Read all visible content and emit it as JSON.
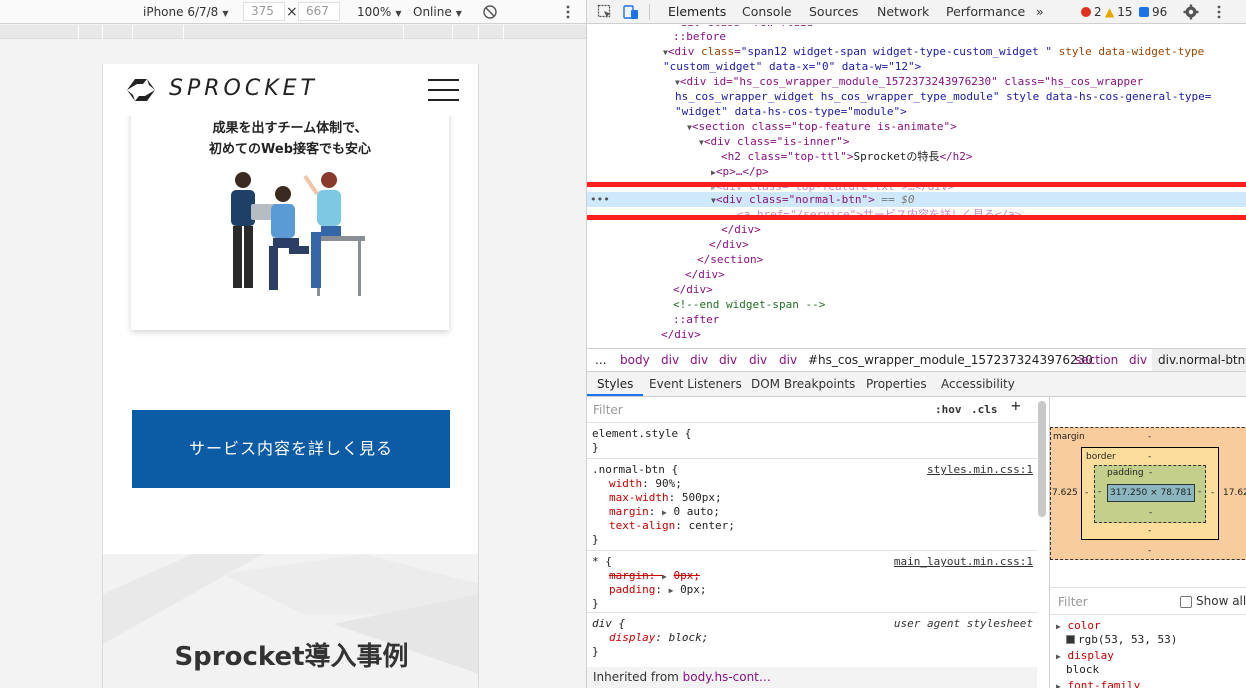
{
  "device_toolbar": {
    "device": "iPhone 6/7/8",
    "width": "375",
    "times": "×",
    "height": "667",
    "zoom": "100%",
    "network": "Online"
  },
  "site": {
    "logo_text": "SPROCKET",
    "feature_line1": "成果を出すチーム体制で、",
    "feature_line2": "初めてのWeb接客でも安心",
    "cta_label": "サービス内容を詳しく見る",
    "cases_title": "Sprocket導入事例"
  },
  "devtools": {
    "tabs": [
      "Elements",
      "Console",
      "Sources",
      "Network",
      "Performance",
      "»"
    ],
    "errors": "2",
    "warnings": "15",
    "messages": "96",
    "dom": {
      "l0": "::before",
      "l1_tag": "<div ",
      "l1_a1": "class",
      "l1_v1": "\"span12 widget-span widget-type-custom_widget \"",
      "l1_a2": " style data-widget-type",
      "l2": "\"custom_widget\" data-x=\"0\" data-w=\"12\">",
      "l3": "<div id=\"hs_cos_wrapper_module_1572373243976230\" class=\"hs_cos_wrapper",
      "l4": "hs_cos_wrapper_widget hs_cos_wrapper_type_module\" style data-hs-cos-general-type=",
      "l5": "\"widget\" data-hs-cos-type=\"module\">",
      "l6": "<section class=\"top-feature is-animate\">",
      "l7": "<div class=\"is-inner\">",
      "l8_open": "<h2 class=\"top-ttl\">",
      "l8_text": "Sprocketの特長",
      "l8_close": "</h2>",
      "l9": "<p>…</p>",
      "l10": "<div class=\"top-feature-txt\">…</div>",
      "l11_tag": "<div class=\"normal-btn\">",
      "l11_eq": " == $0",
      "l12": "<a href=\"/service\">サービス内容を詳しく見る</a>",
      "l13": "</div>",
      "l14": "</div>",
      "l15": "</section>",
      "l16": "</div>",
      "l17": "</div>",
      "l18": "<!--end widget-span -->",
      "l19": "::after",
      "l20": "</div>"
    },
    "breadcrumbs": [
      "...",
      "body",
      "div",
      "div",
      "div",
      "div",
      "div",
      "#hs_cos_wrapper_module_1572373243976230",
      "section",
      "div",
      "div.normal-btn"
    ],
    "sub_tabs": [
      "Styles",
      "Event Listeners",
      "DOM Breakpoints",
      "Properties",
      "Accessibility"
    ],
    "styles": {
      "filter_placeholder": "Filter",
      "hov": ":hov",
      "cls": ".cls",
      "plus": "+",
      "element_style": "element.style {",
      "close": "}",
      "r2_sel": ".normal-btn {",
      "r2_src": "styles.min.css:1",
      "r2_p1": "width",
      "r2_v1": "90%;",
      "r2_p2": "max-width",
      "r2_v2": "500px;",
      "r2_p3": "margin",
      "r2_v3": "0 auto;",
      "r2_p4": "text-align",
      "r2_v4": "center;",
      "r3_sel": "* {",
      "r3_src": "main_layout.min.css:1",
      "r3_p1": "margin",
      "r3_v1": "0px;",
      "r3_p2": "padding",
      "r3_v2": "0px;",
      "r4_sel": "div {",
      "r4_src": "user agent stylesheet",
      "r4_p1": "display",
      "r4_v1": "block;",
      "inherited_label": "Inherited from ",
      "inherited_sel": "body.hs-cont…"
    },
    "box_model": {
      "margin_label": "margin",
      "border_label": "border",
      "padding_label": "padding",
      "dash": "-",
      "content_size": "317.250 × 78.781",
      "margin_left": "7.625",
      "margin_right": "17.62"
    },
    "computed": {
      "filter_placeholder": "Filter",
      "show_all": "Show all",
      "p1": "color",
      "v1": "rgb(53, 53, 53)",
      "p2": "display",
      "v2": "block",
      "p3": "font-family"
    }
  },
  "colors": {
    "cta_blue": "#0c5ba5",
    "selection": "#cfe8fc",
    "highlight_red": "#ff1f1f"
  }
}
